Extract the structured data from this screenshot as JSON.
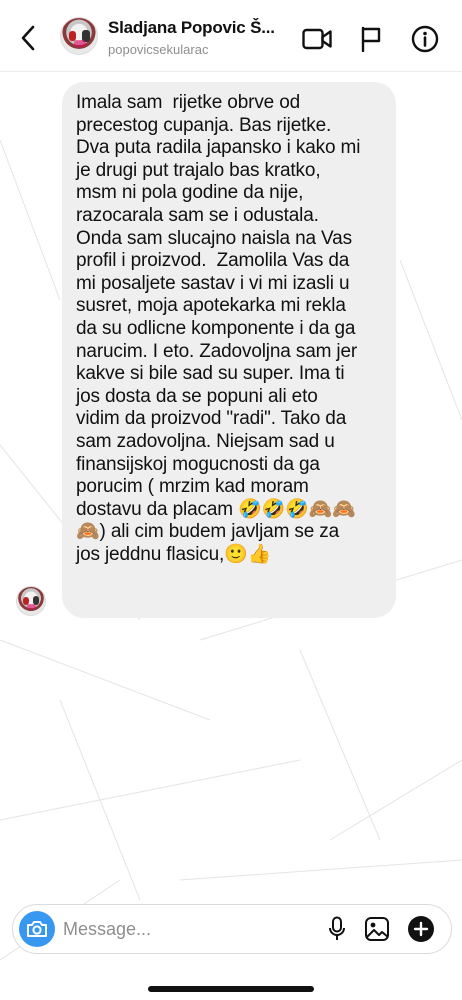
{
  "header": {
    "back_icon": "chevron-left-icon",
    "contact_name": "Sladjana Popovic Š...",
    "contact_username": "popovicsekularac",
    "icons": [
      "video-call-icon",
      "flag-icon",
      "info-icon"
    ]
  },
  "conversation": {
    "messages": [
      {
        "sender": "contact",
        "text": "Imala sam  rijetke obrve od\nprecestog cupanja. Bas rijetke.\nDva puta radila japansko i kako mi\nje drugi put trajalo bas kratko,\nmsm ni pola godine da nije,\nrazocarala sam se i odustala.\nOnda sam slucajno naisla na Vas\nprofil i proizvod.  Zamolila Vas da\nmi posaljete sastav i vi mi izasli u\nsusret, moja apotekarka mi rekla\nda su odlicne komponente i da ga\nnarucim. I eto. Zadovoljna sam jer\nkakve si bile sad su super. Ima ti\njos dosta da se popuni ali eto\nvidim da proizvod \"radi\". Tako da\nsam zadovoljna. Niejsam sad u\nfinansijskoj mogucnosti da ga\nporucim ( mrzim kad moram\ndostavu da placam 🤣🤣🤣🙈🙈\n🙈) ali cim budem javljam se za\njos jeddnu flasicu,🙂👍"
      }
    ]
  },
  "composer": {
    "placeholder": "Message...",
    "value": "",
    "icons": [
      "camera-icon",
      "microphone-icon",
      "gallery-icon",
      "plus-icon"
    ]
  },
  "colors": {
    "bubble_bg": "#efefef",
    "camera_button": "#3897f0",
    "secondary_text": "#8e8e8e"
  }
}
